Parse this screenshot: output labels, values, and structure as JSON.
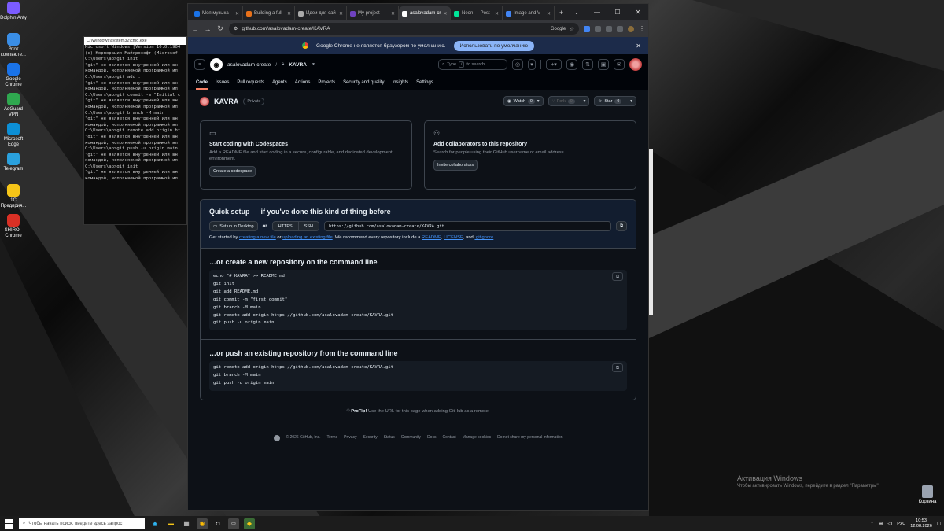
{
  "desktop": {
    "icons": [
      {
        "label": "Dolphin Anty",
        "icon": "dolphin-icon",
        "color": "#7b5cff"
      },
      {
        "label": "Этот компьюте...",
        "icon": "computer-icon",
        "color": "#3a8ee6"
      },
      {
        "label": "Google Chrome",
        "icon": "chrome-icon",
        "color": "#1a73e8"
      },
      {
        "label": "AdGuard VPN",
        "icon": "adguard-icon",
        "color": "#2fa84f"
      },
      {
        "label": "Microsoft Edge",
        "icon": "edge-icon",
        "color": "#0c8fd6"
      },
      {
        "label": "Telegram",
        "icon": "telegram-icon",
        "color": "#2aa1de"
      },
      {
        "label": "1С Предприя...",
        "icon": "onec-icon",
        "color": "#f5c518"
      },
      {
        "label": "SHIRO - Chrome",
        "icon": "shiro-chrome-icon",
        "color": "#d93025"
      }
    ],
    "recycle_bin": "Корзина",
    "activation": {
      "title": "Активация Windows",
      "subtitle": "Чтобы активировать Windows, перейдите в раздел \"Параметры\"."
    }
  },
  "cmd": {
    "title": "C:\\Windows\\system32\\cmd.exe",
    "lines": [
      "Microsoft Windows [Version 10.0.1904",
      "(c) Корпорация Майкрософт (Microsof",
      "",
      "C:\\Users\\ap>git init",
      "\"git\" не является внутренней или вн",
      "командой, исполняемой программой ил",
      "",
      "C:\\Users\\ap>git add .",
      "\"git\" не является внутренней или вн",
      "командой, исполняемой программой ил",
      "",
      "C:\\Users\\ap>git commit -m \"Initial c",
      "\"git\" не является внутренней или вн",
      "командой, исполняемой программой ил",
      "",
      "C:\\Users\\ap>git branch -M main",
      "\"git\" не является внутренней или вн",
      "командой, исполняемой программой ил",
      "",
      "C:\\Users\\ap>git remote add origin ht",
      "\"git\" не является внутренней или вн",
      "командой, исполняемой программой ил",
      "",
      "C:\\Users\\ap>git push -u origin main",
      "\"git\" не является внутренней или вн",
      "командой, исполняемой программой ил",
      "",
      "C:\\Users\\ap>git init",
      "\"git\" не является внутренней или вн",
      "командой, исполняемой программой ил"
    ]
  },
  "browser": {
    "tabs": [
      {
        "label": "Моя музыка",
        "color": "#1a73e8",
        "active": false
      },
      {
        "label": "Building a full",
        "color": "#e8711a",
        "active": false
      },
      {
        "label": "Идеи для сай",
        "color": "#aaaaaa",
        "active": false
      },
      {
        "label": "My project",
        "color": "#6f42c1",
        "active": false
      },
      {
        "label": "asalovadam-cr",
        "color": "#ffffff",
        "active": true
      },
      {
        "label": "Neon — Post",
        "color": "#00e599",
        "active": false
      },
      {
        "label": "Image and V",
        "color": "#4285f4",
        "active": false
      }
    ],
    "new_tab": "+",
    "url": "github.com/asalovadam-create/KAVRA",
    "google_badge": "Google",
    "infobar": {
      "text": "Google Chrome не является браузером по умолчанию.",
      "button": "Использовать по умолчанию"
    }
  },
  "github": {
    "owner": "asalovadam-create",
    "repo": "KAVRA",
    "search_placeholder": "Type",
    "search_hint": "to search",
    "search_key": "/",
    "nav": [
      "Code",
      "Issues",
      "Pull requests",
      "Agents",
      "Actions",
      "Projects",
      "Security and quality",
      "Insights",
      "Settings"
    ],
    "visibility": "Private",
    "watch": {
      "label": "Watch",
      "count": "0"
    },
    "fork": {
      "label": "Fork",
      "count": "0"
    },
    "star": {
      "label": "Star",
      "count": "0"
    },
    "codespaces": {
      "title": "Start coding with Codespaces",
      "desc": "Add a README file and start coding in a secure, configurable, and dedicated development environment.",
      "button": "Create a codespace"
    },
    "collab": {
      "title": "Add collaborators to this repository",
      "desc": "Search for people using their GitHub username or email address.",
      "button": "Invite collaborators"
    },
    "quick_setup": {
      "title": "Quick setup — if you've done this kind of thing before",
      "desktop_button": "Set up in Desktop",
      "or": "or",
      "https": "HTTPS",
      "ssh": "SSH",
      "clone_url": "https://github.com/asalovadam-create/KAVRA.git",
      "hint_prefix": "Get started by",
      "hint_link1": "creating a new file",
      "hint_or": "or",
      "hint_link2": "uploading an existing file",
      "hint_mid": ". We recommend every repository include a",
      "hint_link3": "README",
      "hint_comma": ",",
      "hint_link4": "LICENSE",
      "hint_and": ", and",
      "hint_link5": ".gitignore",
      "hint_end": "."
    },
    "create_section": {
      "title": "…or create a new repository on the command line",
      "lines": [
        "echo \"# KAVRA\" >> README.md",
        "git init",
        "git add README.md",
        "git commit -m \"first commit\"",
        "git branch -M main",
        "git remote add origin https://github.com/asalovadam-create/KAVRA.git",
        "git push -u origin main"
      ]
    },
    "push_section": {
      "title": "…or push an existing repository from the command line",
      "lines": [
        "git remote add origin https://github.com/asalovadam-create/KAVRA.git",
        "git branch -M main",
        "git push -u origin main"
      ]
    },
    "protip": {
      "label": "ProTip!",
      "text": "Use the URL for this page when adding GitHub as a remote."
    },
    "footer": [
      "© 2026 GitHub, Inc.",
      "Terms",
      "Privacy",
      "Security",
      "Status",
      "Community",
      "Docs",
      "Contact",
      "Manage cookies",
      "Do not share my personal information"
    ]
  },
  "taskbar": {
    "search_placeholder": "Чтобы начать поиск, введите здесь запрос",
    "lang": "РУС",
    "time": "10:53",
    "date": "12.08.2026"
  }
}
